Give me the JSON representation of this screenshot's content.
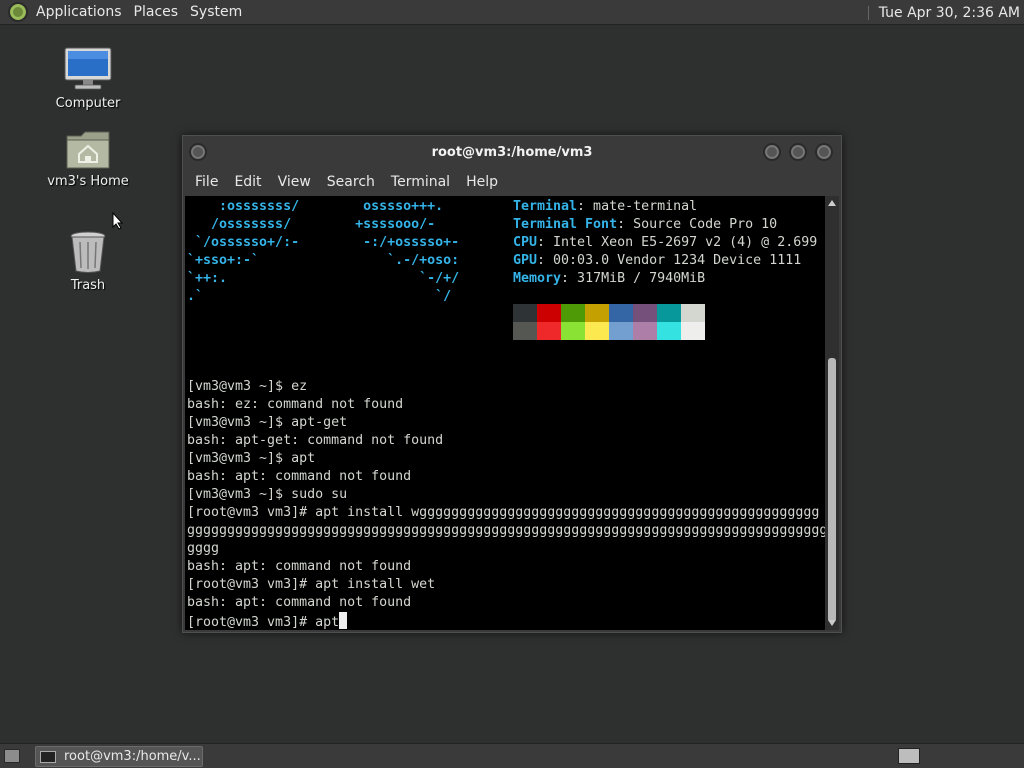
{
  "top_panel": {
    "menus": [
      "Applications",
      "Places",
      "System"
    ],
    "clock": "Tue Apr 30,  2:36 AM"
  },
  "desktop": {
    "icons": [
      {
        "label": "Computer",
        "icon": "computer-icon"
      },
      {
        "label": "vm3's Home",
        "icon": "home-folder-icon"
      },
      {
        "label": "Trash",
        "icon": "trash-icon"
      }
    ]
  },
  "window": {
    "title": "root@vm3:/home/vm3",
    "menus": [
      "File",
      "Edit",
      "View",
      "Search",
      "Terminal",
      "Help"
    ]
  },
  "terminal": {
    "logo_lines": [
      "    :osssssss/        osssso+++.",
      "   /osssssss/        +ssssooo/-",
      " `/ossssso+/:-        -:/+osssso+-",
      "`+sso+:-`                `.-/+oso:",
      "`++:.                        `-/+/",
      ".`                             `/"
    ],
    "info": [
      {
        "key": "Terminal",
        "value": ": mate-terminal"
      },
      {
        "key": "Terminal Font",
        "value": ": Source Code Pro 10"
      },
      {
        "key": "CPU",
        "value": ": Intel Xeon E5-2697 v2 (4) @ 2.699"
      },
      {
        "key": "GPU",
        "value": ": 00:03.0 Vendor 1234 Device 1111"
      },
      {
        "key": "Memory",
        "value": ": 317MiB / 7940MiB"
      }
    ],
    "palette_dark": [
      "#2e3436",
      "#cc0000",
      "#4e9a06",
      "#c4a000",
      "#3465a4",
      "#75507b",
      "#06989a",
      "#d3d7cf"
    ],
    "palette_bright": [
      "#555753",
      "#ef2929",
      "#8ae234",
      "#fce94f",
      "#729fcf",
      "#ad7fa8",
      "#34e2e2",
      "#eeeeec"
    ],
    "lines": [
      "[vm3@vm3 ~]$ ez",
      "bash: ez: command not found",
      "[vm3@vm3 ~]$ apt-get",
      "bash: apt-get: command not found",
      "[vm3@vm3 ~]$ apt",
      "bash: apt: command not found",
      "[vm3@vm3 ~]$ sudo su",
      "[root@vm3 vm3]# apt install wgggggggggggggggggggggggggggggggggggggggggggggggggg",
      "gggggggggggggggggggggggggggggggggggggggggggggggggggggggggggggggggggggggggggggggg",
      "gggg",
      "bash: apt: command not found",
      "[root@vm3 vm3]# apt install wet",
      "bash: apt: command not found"
    ],
    "prompt_line": "[root@vm3 vm3]# apt"
  },
  "bottom_panel": {
    "task_label": "root@vm3:/home/v..."
  }
}
